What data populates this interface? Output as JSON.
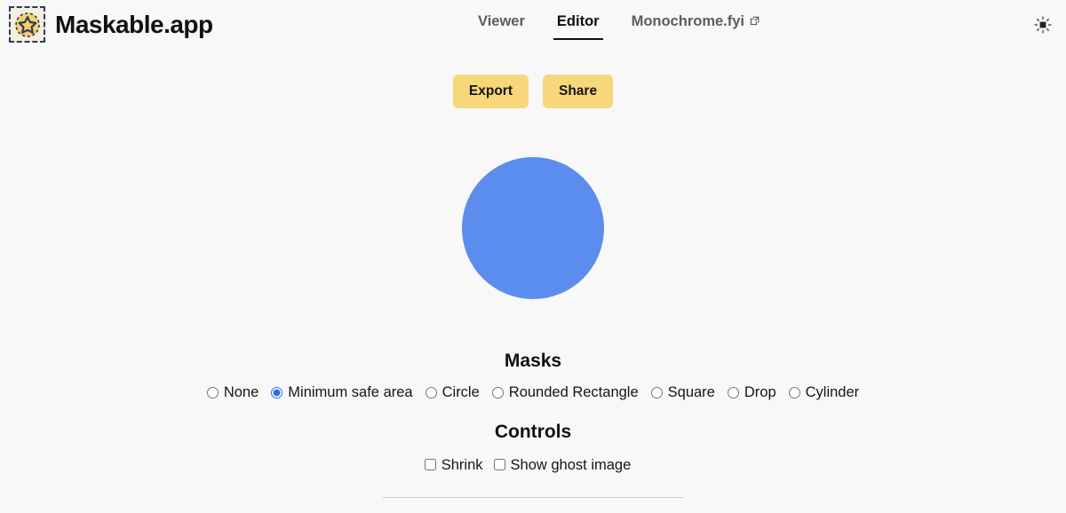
{
  "header": {
    "brand_name": "Maskable.app",
    "logo_icon": "maskable-star-logo",
    "nav": [
      {
        "label": "Viewer",
        "active": false,
        "external": false
      },
      {
        "label": "Editor",
        "active": true,
        "external": false
      },
      {
        "label": "Monochrome.fyi",
        "active": false,
        "external": true,
        "external_icon": "external-link-icon"
      }
    ],
    "theme_toggle_icon": "sun-icon"
  },
  "toolbar": {
    "export_label": "Export",
    "share_label": "Share"
  },
  "preview": {
    "shape": "circle",
    "color": "#5b8def",
    "mask": "Minimum safe area"
  },
  "masks": {
    "title": "Masks",
    "selected": "Minimum safe area",
    "options": [
      {
        "label": "None",
        "checked": false
      },
      {
        "label": "Minimum safe area",
        "checked": true
      },
      {
        "label": "Circle",
        "checked": false
      },
      {
        "label": "Rounded Rectangle",
        "checked": false
      },
      {
        "label": "Square",
        "checked": false
      },
      {
        "label": "Drop",
        "checked": false
      },
      {
        "label": "Cylinder",
        "checked": false
      }
    ]
  },
  "controls": {
    "title": "Controls",
    "options": [
      {
        "label": "Shrink",
        "checked": false
      },
      {
        "label": "Show ghost image",
        "checked": false
      }
    ]
  },
  "colors": {
    "background": "#f8f8f8",
    "accent_button": "#f6d77a",
    "preview_blue": "#5b8def",
    "radio_accent": "#2b6cf5",
    "logo_gold": "#f5d268",
    "logo_navy": "#2b3a62",
    "divider": "#cfcfcf"
  }
}
